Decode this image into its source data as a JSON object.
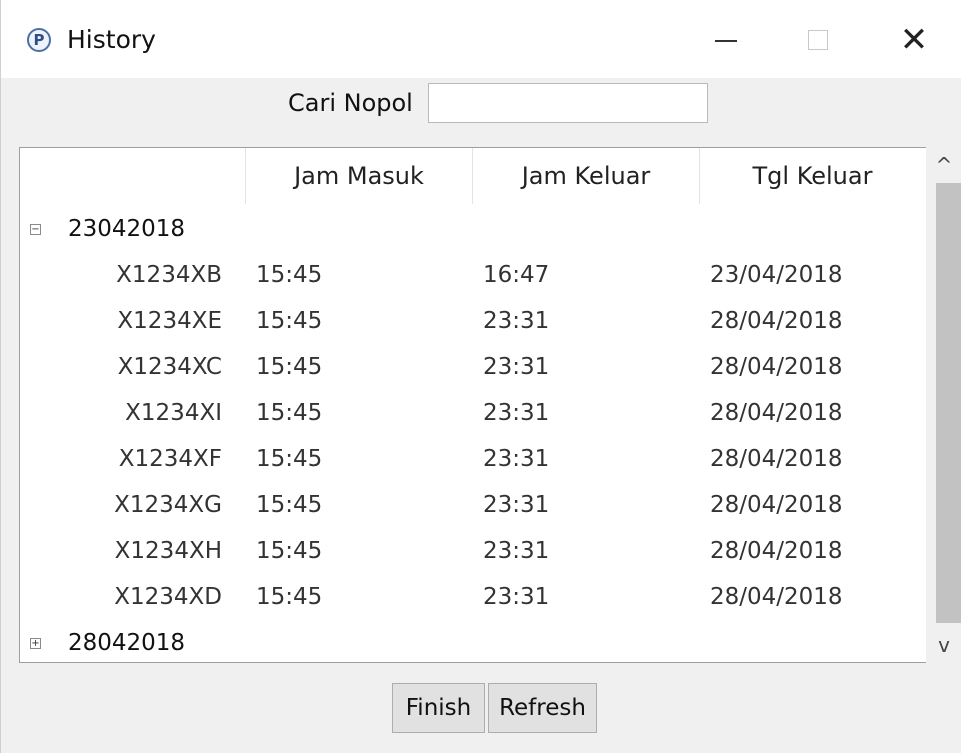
{
  "window": {
    "title": "History",
    "icon_letter": "P",
    "minimize_glyph": "minimize-icon",
    "maximize_glyph": "maximize-icon",
    "close_symbol": "✕"
  },
  "search": {
    "label": "Cari Nopol",
    "value": "",
    "placeholder": ""
  },
  "table": {
    "columns": [
      "",
      "Jam Masuk",
      "Jam Keluar",
      "Tgl Keluar"
    ],
    "groups": [
      {
        "label": "23042018",
        "expanded": true,
        "expander_symbol": "−",
        "rows": [
          {
            "nopol": "X1234XB",
            "jam_masuk": "15:45",
            "jam_keluar": "16:47",
            "tgl_keluar": "23/04/2018"
          },
          {
            "nopol": "X1234XE",
            "jam_masuk": "15:45",
            "jam_keluar": "23:31",
            "tgl_keluar": "28/04/2018"
          },
          {
            "nopol": "X1234XC",
            "jam_masuk": "15:45",
            "jam_keluar": "23:31",
            "tgl_keluar": "28/04/2018"
          },
          {
            "nopol": "X1234XI",
            "jam_masuk": "15:45",
            "jam_keluar": "23:31",
            "tgl_keluar": "28/04/2018"
          },
          {
            "nopol": "X1234XF",
            "jam_masuk": "15:45",
            "jam_keluar": "23:31",
            "tgl_keluar": "28/04/2018"
          },
          {
            "nopol": "X1234XG",
            "jam_masuk": "15:45",
            "jam_keluar": "23:31",
            "tgl_keluar": "28/04/2018"
          },
          {
            "nopol": "X1234XH",
            "jam_masuk": "15:45",
            "jam_keluar": "23:31",
            "tgl_keluar": "28/04/2018"
          },
          {
            "nopol": "X1234XD",
            "jam_masuk": "15:45",
            "jam_keluar": "23:31",
            "tgl_keluar": "28/04/2018"
          }
        ]
      },
      {
        "label": "28042018",
        "expanded": false,
        "expander_symbol": "+",
        "rows": []
      }
    ]
  },
  "scrollbar": {
    "up_symbol": "^",
    "down_symbol": "v"
  },
  "buttons": {
    "finish": "Finish",
    "refresh": "Refresh"
  }
}
